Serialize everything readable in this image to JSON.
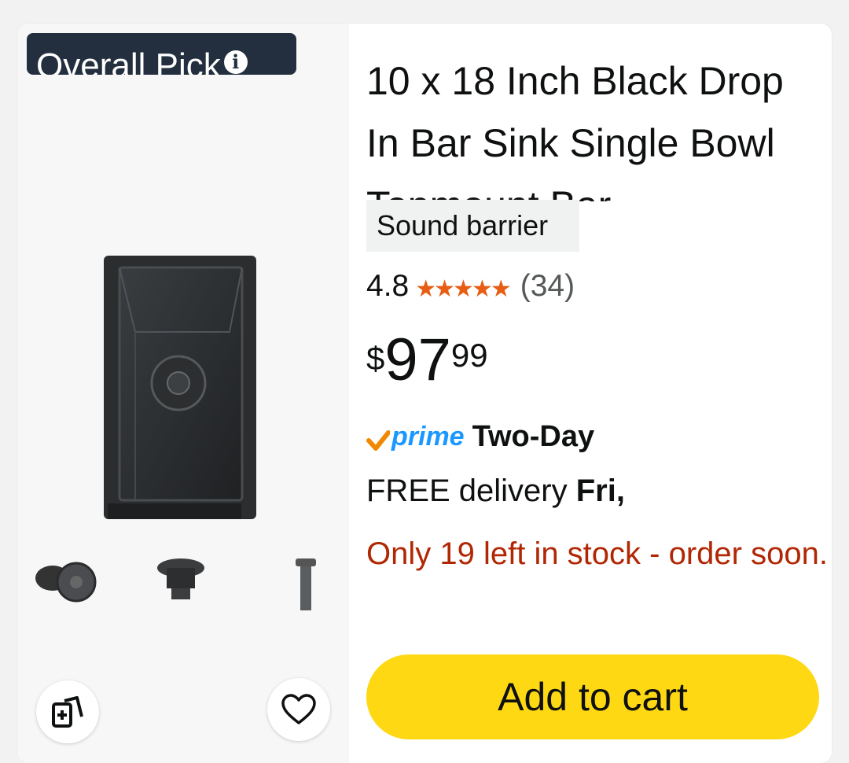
{
  "badge": {
    "label": "Overall Pick",
    "info_icon": "info-icon"
  },
  "product": {
    "title": "10 x 18 Inch Black Drop In Bar Sink Single Bowl Topmount Bar",
    "tag": "Sound barrier",
    "rating_value": "4.8",
    "rating_stars": 4.8,
    "review_count": "(34)",
    "price": {
      "currency": "$",
      "whole": "97",
      "fraction": "99"
    },
    "prime_label": "prime",
    "shipping_speed": "Two-Day",
    "delivery_prefix": "FREE delivery ",
    "delivery_day": "Fri,",
    "stock_message": "Only 19 left in stock - order soon."
  },
  "actions": {
    "add_to_cart": "Add to cart",
    "compare_icon": "compare-icon",
    "wishlist_icon": "heart-icon"
  },
  "colors": {
    "accent_button": "#ffd814",
    "badge_bg": "#232f3e",
    "star": "#e75d14",
    "prime": "#1a98ff",
    "stock_warning": "#b12704"
  }
}
